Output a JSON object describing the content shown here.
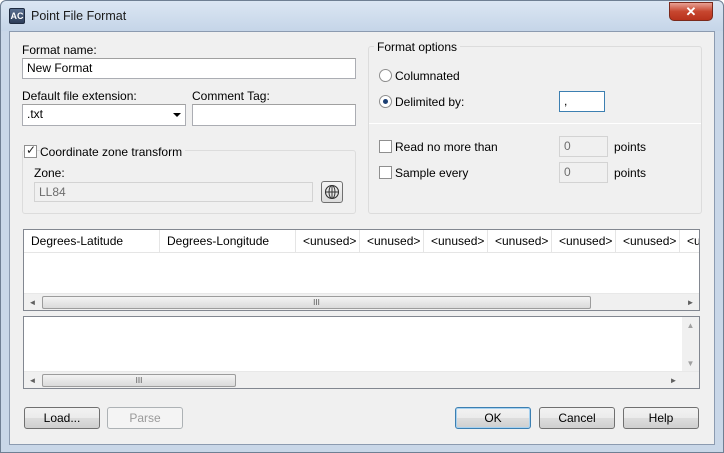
{
  "window": {
    "title": "Point File Format",
    "app_icon_text": "AC",
    "close_symbol": "✕"
  },
  "left": {
    "format_name_label": "Format name:",
    "format_name_value": "New Format",
    "default_ext_label": "Default file extension:",
    "default_ext_value": ".txt",
    "comment_tag_label": "Comment Tag:",
    "comment_tag_value": "",
    "coord_transform_label": "Coordinate zone transform",
    "coord_transform_checked": true,
    "zone_label": "Zone:",
    "zone_value": "LL84"
  },
  "format_options": {
    "group_label": "Format options",
    "columnated_label": "Columnated",
    "delimited_label": "Delimited by:",
    "selected": "delimited",
    "delimiter_value": ",",
    "read_no_more_label": "Read no more than",
    "read_no_more_value": "0",
    "read_no_more_unit": "points",
    "sample_every_label": "Sample every",
    "sample_every_value": "0",
    "sample_every_unit": "points"
  },
  "columns": [
    "Degrees-Latitude",
    "Degrees-Longitude",
    "<unused>",
    "<unused>",
    "<unused>",
    "<unused>",
    "<unused>",
    "<unused>",
    "<u"
  ],
  "scroll": {
    "left_arrow": "◄",
    "right_arrow": "►",
    "up_arrow": "▲",
    "down_arrow": "▼",
    "grip": "III"
  },
  "buttons": {
    "load": "Load...",
    "parse": "Parse",
    "ok": "OK",
    "cancel": "Cancel",
    "help": "Help"
  },
  "icons": {
    "globe": "globe-icon"
  }
}
